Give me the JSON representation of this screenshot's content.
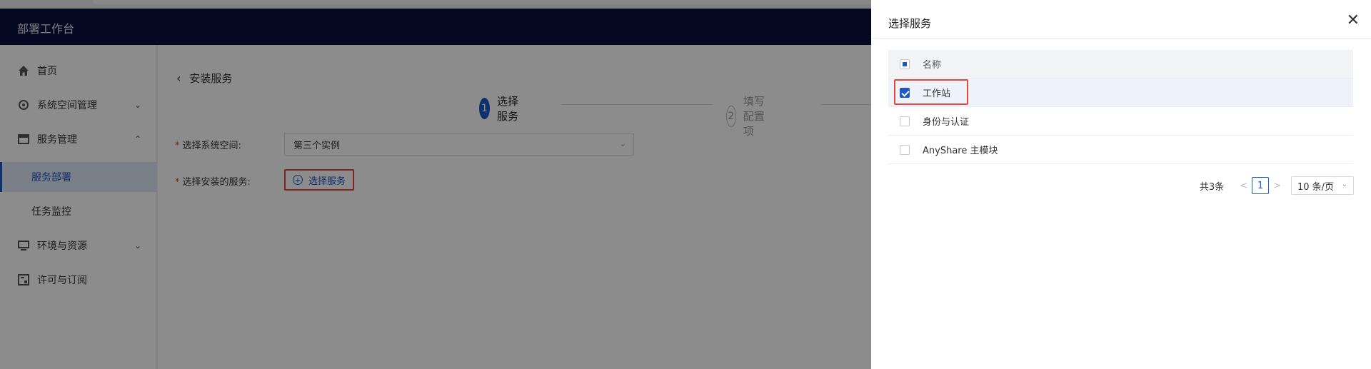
{
  "header": {
    "title": "部署工作台"
  },
  "sidebar": {
    "items": [
      {
        "label": "首页",
        "icon": "home-icon"
      },
      {
        "label": "系统空间管理",
        "icon": "gear-icon",
        "chevron": "⌄"
      },
      {
        "label": "服务管理",
        "icon": "grid-icon",
        "chevron": "⌃"
      },
      {
        "label": "服务部署"
      },
      {
        "label": "任务监控"
      },
      {
        "label": "环境与资源",
        "icon": "monitor-icon",
        "chevron": "⌄"
      },
      {
        "label": "许可与订阅",
        "icon": "license-icon"
      }
    ]
  },
  "main": {
    "back_label": "安装服务",
    "steps": [
      {
        "num": "1",
        "label": "选择服务"
      },
      {
        "num": "2",
        "label": "填写配置项"
      }
    ],
    "form": {
      "space_label": "选择系统空间:",
      "space_value": "第三个实例",
      "service_label": "选择安装的服务:",
      "add_label": "选择服务"
    }
  },
  "drawer": {
    "title": "选择服务",
    "close": "✕",
    "table": {
      "header": "名称",
      "rows": [
        "工作站",
        "身份与认证",
        "AnyShare 主模块"
      ]
    },
    "pager": {
      "total": "共3条",
      "prev": "<",
      "page": "1",
      "next": ">",
      "size": "10 条/页"
    }
  }
}
